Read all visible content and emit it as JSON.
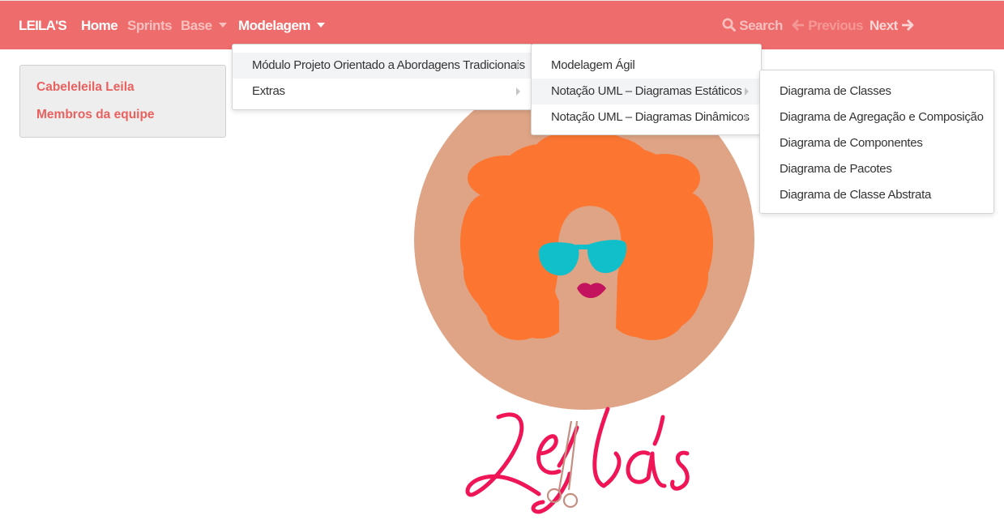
{
  "navbar": {
    "brand": "LEILA'S",
    "links": {
      "home": "Home",
      "sprints": "Sprints",
      "base": "Base",
      "modelagem": "Modelagem"
    },
    "right": {
      "search": "Search",
      "previous": "Previous",
      "next": "Next"
    },
    "icons": [
      "search-icon",
      "arrow-left-icon",
      "arrow-right-icon",
      "caret-down-icon"
    ]
  },
  "sidebar": {
    "items": [
      {
        "label": "Cabeleleila Leila"
      },
      {
        "label": "Membros da equipe"
      }
    ]
  },
  "dropdown_modelagem": {
    "items": [
      {
        "label": "Módulo Projeto Orientado a Abordagens Tradicionais"
      },
      {
        "label": "Extras"
      }
    ]
  },
  "submenu_modulo": {
    "items": [
      {
        "label": "Modelagem Ágil"
      },
      {
        "label": "Notação UML – Diagramas Estáticos"
      },
      {
        "label": "Notação UML – Diagramas Dinâmicos"
      }
    ]
  },
  "submenu_estaticos": {
    "items": [
      {
        "label": "Diagrama de Classes"
      },
      {
        "label": "Diagrama de Agregação e Composição"
      },
      {
        "label": "Diagrama de Componentes"
      },
      {
        "label": "Diagrama de Pacotes"
      },
      {
        "label": "Diagrama de Classe Abstrata"
      }
    ]
  },
  "logo": {
    "text": "Leila's",
    "colors": {
      "circle": "#dfa485",
      "hair": "#fc7632",
      "glasses": "#11bfcb",
      "lips": "#c4135e",
      "script": "#ef1557",
      "scissors": "#c48f81"
    }
  },
  "colors": {
    "navbar": "#ee6c6b",
    "accent": "#e9615f",
    "panel": "#eeeeee"
  }
}
